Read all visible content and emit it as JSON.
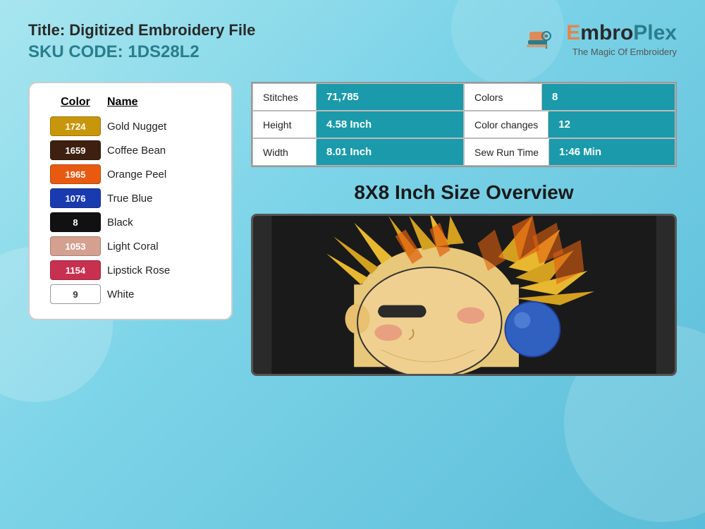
{
  "header": {
    "title_prefix": "Title:",
    "title_value": "Digitized Embroidery File",
    "sku_label": "SKU CODE:",
    "sku_value": "1DS28L2",
    "logo_name": "EmbroPlex",
    "logo_tagline": "The Magic Of Embroidery"
  },
  "color_table": {
    "col_header_color": "Color",
    "col_header_name": "Name",
    "rows": [
      {
        "code": "1724",
        "hex": "#c8960a",
        "name": "Gold Nugget",
        "white": false
      },
      {
        "code": "1659",
        "hex": "#3d2010",
        "name": "Coffee Bean",
        "white": false
      },
      {
        "code": "1965",
        "hex": "#e85a10",
        "name": "Orange Peel",
        "white": false
      },
      {
        "code": "1076",
        "hex": "#1a3bb0",
        "name": "True Blue",
        "white": false
      },
      {
        "code": "8",
        "hex": "#111111",
        "name": "Black",
        "white": false
      },
      {
        "code": "1053",
        "hex": "#d4a090",
        "name": "Light Coral",
        "white": false
      },
      {
        "code": "1154",
        "hex": "#c83050",
        "name": "Lipstick Rose",
        "white": false
      },
      {
        "code": "9",
        "hex": "#ffffff",
        "name": "White",
        "white": true
      }
    ]
  },
  "stats": [
    {
      "label": "Stitches",
      "value": "71,785",
      "label_right": "Colors",
      "value_right": "8"
    },
    {
      "label": "Height",
      "value": "4.58 Inch",
      "label_right": "Color changes",
      "value_right": "12"
    },
    {
      "label": "Width",
      "value": "8.01 Inch",
      "label_right": "Sew Run Time",
      "value_right": "1:46 Min"
    }
  ],
  "overview_title": "8X8 Inch Size Overview"
}
